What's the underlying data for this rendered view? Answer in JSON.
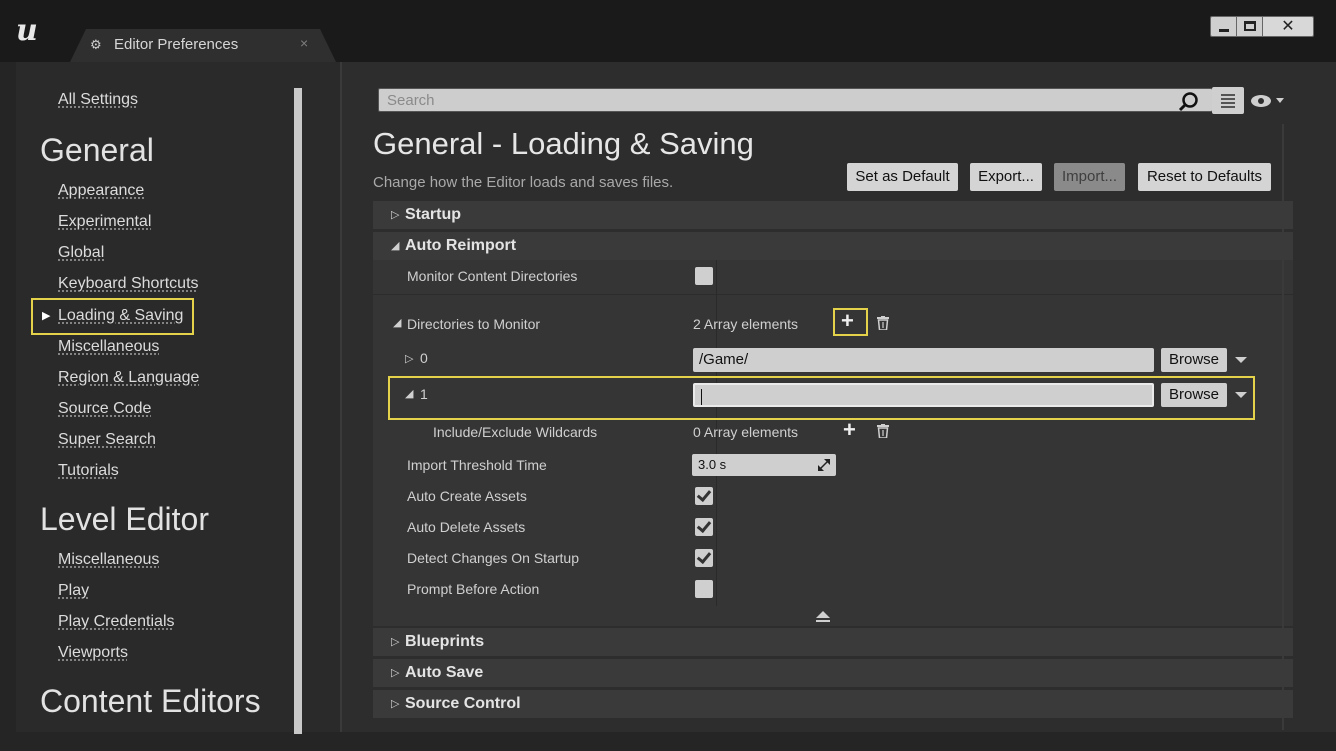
{
  "app": {
    "tab_title": "Editor Preferences",
    "tab_close": "×",
    "window_close": "✕"
  },
  "sidebar": {
    "all_settings": "All Settings",
    "sections": [
      {
        "heading": "General",
        "items": [
          "Appearance",
          "Experimental",
          "Global",
          "Keyboard Shortcuts",
          "Loading & Saving",
          "Miscellaneous",
          "Region & Language",
          "Source Code",
          "Super Search",
          "Tutorials"
        ]
      },
      {
        "heading": "Level Editor",
        "items": [
          "Miscellaneous",
          "Play",
          "Play Credentials",
          "Viewports"
        ]
      },
      {
        "heading": "Content Editors",
        "items": []
      }
    ],
    "selected_item": "Loading & Saving"
  },
  "search": {
    "placeholder": "Search"
  },
  "page": {
    "title": "General - Loading & Saving",
    "subtitle": "Change how the Editor loads and saves files.",
    "buttons": {
      "set_default": "Set as Default",
      "export": "Export...",
      "import": "Import...",
      "reset": "Reset to Defaults"
    }
  },
  "categories": {
    "startup": "Startup",
    "auto_reimport": "Auto Reimport",
    "blueprints": "Blueprints",
    "auto_save": "Auto Save",
    "source_control": "Source Control"
  },
  "auto_reimport": {
    "monitor_content_directories": {
      "label": "Monitor Content Directories",
      "checked": false
    },
    "directories_to_monitor": {
      "label": "Directories to Monitor",
      "value": "2 Array elements"
    },
    "element_0": {
      "index": "0",
      "path": "/Game/",
      "browse": "Browse"
    },
    "element_1": {
      "index": "1",
      "path": "",
      "browse": "Browse"
    },
    "wildcards": {
      "label": "Include/Exclude Wildcards",
      "value": "0 Array elements"
    },
    "import_threshold": {
      "label": "Import Threshold Time",
      "value": "3.0 s"
    },
    "auto_create": {
      "label": "Auto Create Assets",
      "checked": true
    },
    "auto_delete": {
      "label": "Auto Delete Assets",
      "checked": true
    },
    "detect_changes": {
      "label": "Detect Changes On Startup",
      "checked": true
    },
    "prompt_before": {
      "label": "Prompt Before Action",
      "checked": false
    }
  },
  "colors": {
    "highlight": "#e3d24a",
    "background": "#252525",
    "panel": "#353535"
  }
}
